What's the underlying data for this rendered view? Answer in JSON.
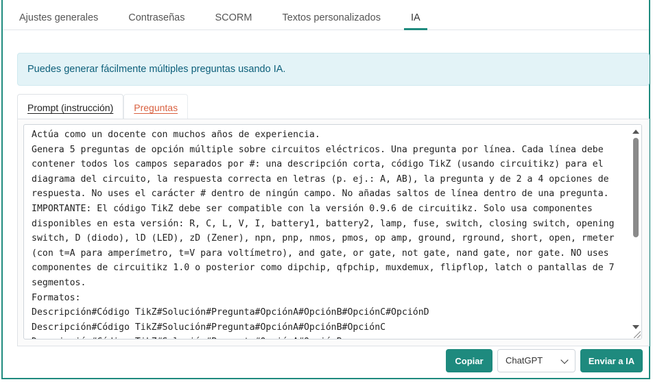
{
  "top_tabs": [
    {
      "label": "Ajustes generales",
      "active": false
    },
    {
      "label": "Contraseñas",
      "active": false
    },
    {
      "label": "SCORM",
      "active": false
    },
    {
      "label": "Textos personalizados",
      "active": false
    },
    {
      "label": "IA",
      "active": true
    }
  ],
  "alert": {
    "text": "Puedes generar fácilmente múltiples preguntas usando IA."
  },
  "inner_tabs": [
    {
      "label": "Prompt (instrucción)",
      "active": true
    },
    {
      "label": "Preguntas",
      "active": false
    }
  ],
  "prompt": {
    "value": "Actúa como un docente con muchos años de experiencia.\nGenera 5 preguntas de opción múltiple sobre circuitos eléctricos. Una pregunta por línea. Cada línea debe contener todos los campos separados por #: una descripción corta, código TikZ (usando circuitikz) para el diagrama del circuito, la respuesta correcta en letras (p. ej.: A, AB), la pregunta y de 2 a 4 opciones de respuesta. No uses el carácter # dentro de ningún campo. No añadas saltos de línea dentro de una pregunta.\nIMPORTANTE: El código TikZ debe ser compatible con la versión 0.9.6 de circuitikz. Solo usa componentes disponibles en esta versión: R, C, L, V, I, battery1, battery2, lamp, fuse, switch, closing switch, opening switch, D (diodo), lD (LED), zD (Zener), npn, pnp, nmos, pmos, op amp, ground, rground, short, open, rmeter (con t=A para amperímetro, t=V para voltímetro), and gate, or gate, not gate, nand gate, nor gate. NO uses componentes de circuitikz 1.0 o posterior como dipchip, qfpchip, muxdemux, flipflop, latch o pantallas de 7 segmentos.\nFormatos:\nDescripción#Código TikZ#Solución#Pregunta#OpciónA#OpciónB#OpciónC#OpciónD\nDescripción#Código TikZ#Solución#Pregunta#OpciónA#OpciónB#OpciónC\nDescripción#Código TikZ#Solución#Pregunta#OpciónA#OpciónB"
  },
  "actions": {
    "copy_label": "Copiar",
    "model_selected": "ChatGPT",
    "send_label": "Enviar a IA"
  },
  "colors": {
    "accent": "#1e8a7e",
    "link": "#d9603f",
    "alert_bg": "#e3f3f7",
    "alert_text": "#0c5f7a"
  }
}
